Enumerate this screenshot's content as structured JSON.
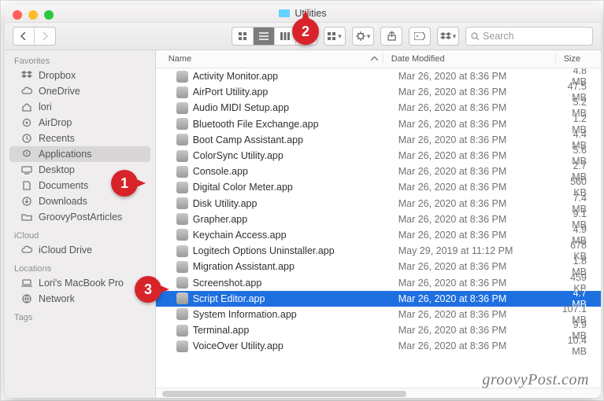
{
  "window": {
    "title": "Utilities"
  },
  "search": {
    "placeholder": "Search"
  },
  "columns": {
    "name": "Name",
    "date": "Date Modified",
    "size": "Size"
  },
  "sidebar": {
    "sections": [
      {
        "title": "Favorites",
        "items": [
          {
            "label": "Dropbox",
            "icon": "dropbox-icon"
          },
          {
            "label": "OneDrive",
            "icon": "cloud-icon"
          },
          {
            "label": "lori",
            "icon": "home-icon"
          },
          {
            "label": "AirDrop",
            "icon": "airdrop-icon"
          },
          {
            "label": "Recents",
            "icon": "clock-icon"
          },
          {
            "label": "Applications",
            "icon": "apps-icon",
            "active": true
          },
          {
            "label": "Desktop",
            "icon": "desktop-icon"
          },
          {
            "label": "Documents",
            "icon": "documents-icon"
          },
          {
            "label": "Downloads",
            "icon": "downloads-icon"
          },
          {
            "label": "GroovyPostArticles",
            "icon": "folder-icon"
          }
        ]
      },
      {
        "title": "iCloud",
        "items": [
          {
            "label": "iCloud Drive",
            "icon": "cloud-icon"
          }
        ]
      },
      {
        "title": "Locations",
        "items": [
          {
            "label": "Lori's MacBook Pro",
            "icon": "laptop-icon"
          },
          {
            "label": "Network",
            "icon": "network-icon"
          }
        ]
      },
      {
        "title": "Tags",
        "items": []
      }
    ]
  },
  "files": [
    {
      "name": "Activity Monitor.app",
      "date": "Mar 26, 2020 at 8:36 PM",
      "size": "4.8 MB"
    },
    {
      "name": "AirPort Utility.app",
      "date": "Mar 26, 2020 at 8:36 PM",
      "size": "47.5 MB"
    },
    {
      "name": "Audio MIDI Setup.app",
      "date": "Mar 26, 2020 at 8:36 PM",
      "size": "5.2 MB"
    },
    {
      "name": "Bluetooth File Exchange.app",
      "date": "Mar 26, 2020 at 8:36 PM",
      "size": "1.2 MB"
    },
    {
      "name": "Boot Camp Assistant.app",
      "date": "Mar 26, 2020 at 8:36 PM",
      "size": "4.4 MB"
    },
    {
      "name": "ColorSync Utility.app",
      "date": "Mar 26, 2020 at 8:36 PM",
      "size": "5.6 MB"
    },
    {
      "name": "Console.app",
      "date": "Mar 26, 2020 at 8:36 PM",
      "size": "2.7 MB"
    },
    {
      "name": "Digital Color Meter.app",
      "date": "Mar 26, 2020 at 8:36 PM",
      "size": "560 KB"
    },
    {
      "name": "Disk Utility.app",
      "date": "Mar 26, 2020 at 8:36 PM",
      "size": "7.4 MB"
    },
    {
      "name": "Grapher.app",
      "date": "Mar 26, 2020 at 8:36 PM",
      "size": "9.1 MB"
    },
    {
      "name": "Keychain Access.app",
      "date": "Mar 26, 2020 at 8:36 PM",
      "size": "4.9 MB"
    },
    {
      "name": "Logitech Options Uninstaller.app",
      "date": "May 29, 2019 at 11:12 PM",
      "size": "678 KB"
    },
    {
      "name": "Migration Assistant.app",
      "date": "Mar 26, 2020 at 8:36 PM",
      "size": "1.8 MB"
    },
    {
      "name": "Screenshot.app",
      "date": "Mar 26, 2020 at 8:36 PM",
      "size": "459 KB"
    },
    {
      "name": "Script Editor.app",
      "date": "Mar 26, 2020 at 8:36 PM",
      "size": "4.7 MB",
      "selected": true
    },
    {
      "name": "System Information.app",
      "date": "Mar 26, 2020 at 8:36 PM",
      "size": "107.1 MB"
    },
    {
      "name": "Terminal.app",
      "date": "Mar 26, 2020 at 8:36 PM",
      "size": "9.9 MB"
    },
    {
      "name": "VoiceOver Utility.app",
      "date": "Mar 26, 2020 at 8:36 PM",
      "size": "10.4 MB"
    }
  ],
  "callouts": {
    "c1": "1",
    "c2": "2",
    "c3": "3"
  },
  "watermark": "groovyPost.com"
}
